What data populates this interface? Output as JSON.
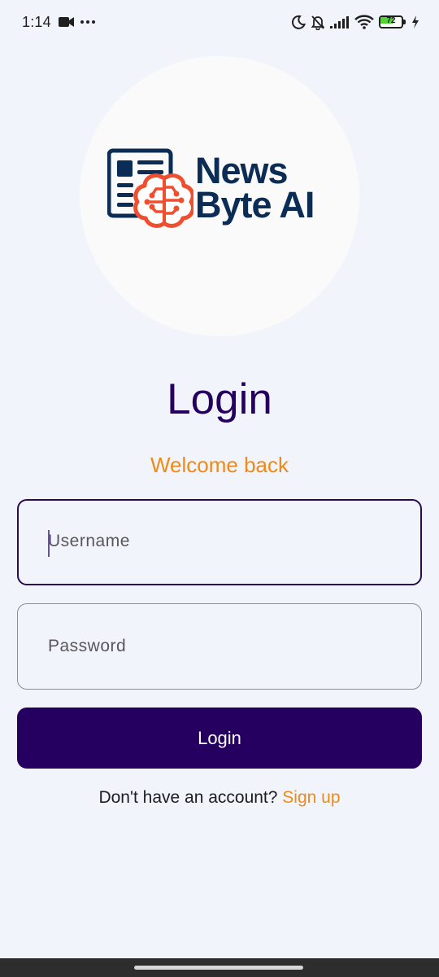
{
  "status_bar": {
    "time": "1:14",
    "battery_level": "72",
    "battery_fraction": 0.72,
    "left_icons": [
      "video-camera-icon",
      "more-dots-icon"
    ],
    "right_icons": [
      "moon-icon",
      "bell-off-icon",
      "signal-icon",
      "wifi-icon",
      "battery-icon",
      "charging-bolt-icon"
    ]
  },
  "logo": {
    "line1": "News",
    "line2": "Byte AI",
    "icons": [
      "newspaper-icon",
      "brain-icon"
    ],
    "colors": {
      "text": "#0b2c55",
      "brain": "#ef4f2f"
    }
  },
  "login": {
    "title": "Login",
    "subtitle": "Welcome back",
    "username_placeholder": "Username",
    "password_placeholder": "Password",
    "button_label": "Login",
    "signup_prompt": "Don't have an account? ",
    "signup_link": "Sign up"
  },
  "colors": {
    "background": "#f1f4fa",
    "primary": "#250060",
    "accent": "#ee8a18"
  }
}
